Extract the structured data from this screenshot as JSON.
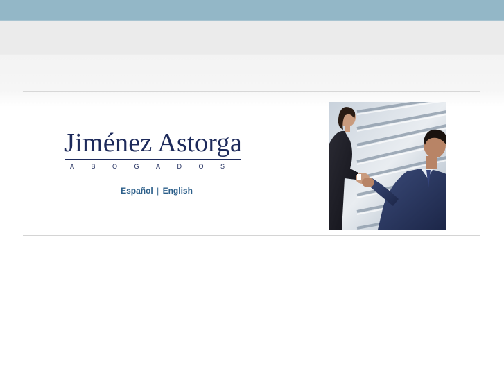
{
  "header": {
    "top_bar_color": "#93b7c7",
    "band_color": "#ebebeb"
  },
  "brand": {
    "name": "Jiménez Astorga",
    "tagline": "ABOGADOS",
    "color": "#1d2a5b"
  },
  "languages": {
    "spanish_label": "Español",
    "separator": "|",
    "english_label": "English",
    "link_color": "#2c5f8a"
  },
  "hero": {
    "image_subject": "handshake-photo"
  }
}
